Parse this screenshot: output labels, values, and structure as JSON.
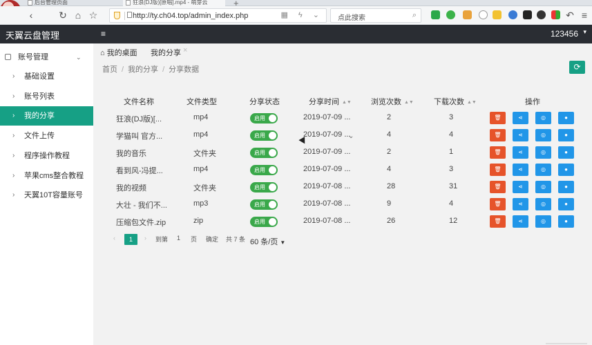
{
  "browser": {
    "tabs": [
      {
        "label": "后台管理页面"
      },
      {
        "label": "狂浪(DJ版)[原唱].mp4 - 萌芽云"
      }
    ],
    "url": "http://ty.ch04.top/admin_index.php",
    "search_placeholder": "点此搜索"
  },
  "app": {
    "logo": "天翼云盘管理",
    "user": "123456",
    "menu_toggle": "≡"
  },
  "sidebar": {
    "header": "账号管理",
    "items": [
      {
        "label": "基础设置"
      },
      {
        "label": "账号列表"
      },
      {
        "label": "我的分享"
      },
      {
        "label": "文件上传"
      },
      {
        "label": "程序操作教程"
      },
      {
        "label": "苹果cms整合教程"
      },
      {
        "label": "天翼10T容量账号"
      }
    ]
  },
  "page_tabs": [
    {
      "label": "我的桌面"
    },
    {
      "label": "我的分享"
    }
  ],
  "breadcrumb": [
    "首页",
    "我的分享",
    "分享数据"
  ],
  "table": {
    "headers": [
      "文件名称",
      "文件类型",
      "分享状态",
      "分享时间",
      "浏览次数",
      "下载次数",
      "操作"
    ],
    "toggle_label": "启用",
    "rows": [
      {
        "name": "狂浪(DJ版)[...",
        "type": "mp4",
        "time": "2019-07-09 ...",
        "views": "2",
        "downloads": "3"
      },
      {
        "name": "学猫叫 官方...",
        "type": "mp4",
        "time": "2019-07-09 ...",
        "views": "4",
        "downloads": "4"
      },
      {
        "name": "我的音乐",
        "type": "文件夹",
        "time": "2019-07-09 ...",
        "views": "2",
        "downloads": "1"
      },
      {
        "name": "看到风-冯提...",
        "type": "mp4",
        "time": "2019-07-09 ...",
        "views": "4",
        "downloads": "3"
      },
      {
        "name": "我的视频",
        "type": "文件夹",
        "time": "2019-07-08 ...",
        "views": "28",
        "downloads": "31"
      },
      {
        "name": "大壮 - 我们不...",
        "type": "mp3",
        "time": "2019-07-08 ...",
        "views": "9",
        "downloads": "4"
      },
      {
        "name": "压缩包文件.zip",
        "type": "zip",
        "time": "2019-07-08 ...",
        "views": "26",
        "downloads": "12"
      }
    ]
  },
  "pagination": {
    "current": "1",
    "goto_label": "到第",
    "goto_value": "1",
    "page_unit": "页",
    "confirm": "确定",
    "total": "共 7 条",
    "page_size": "60 条/页"
  },
  "colors": {
    "primary": "#16a085",
    "danger": "#e6532a",
    "info": "#2196e8",
    "header_bg": "#2a2d33"
  }
}
